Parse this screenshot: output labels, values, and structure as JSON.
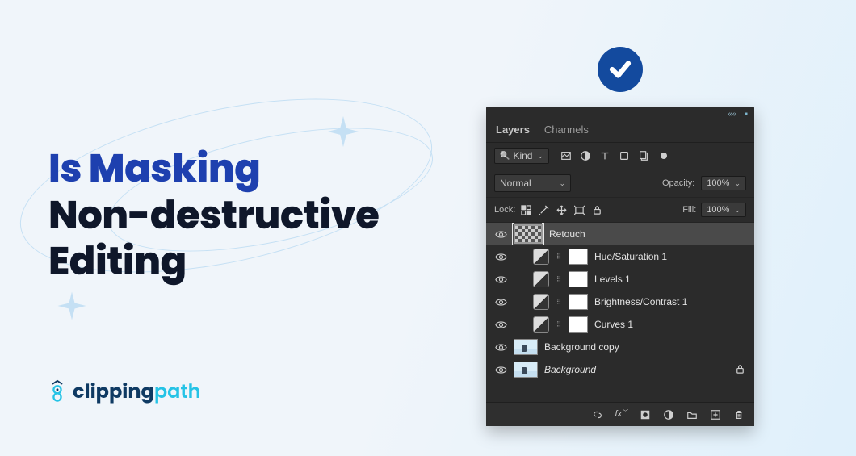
{
  "headline": {
    "line1": "Is Masking",
    "line2": "Non-destructive",
    "line3": "Editing"
  },
  "logo": {
    "part1": "clipping",
    "part2": "path"
  },
  "panel": {
    "tabs": {
      "layers": "Layers",
      "channels": "Channels"
    },
    "kind_label": "Kind",
    "blend_mode": "Normal",
    "opacity_label": "Opacity:",
    "opacity_value": "100%",
    "lock_label": "Lock:",
    "fill_label": "Fill:",
    "fill_value": "100%",
    "layers": [
      {
        "name": "Retouch",
        "type": "checker",
        "visible": true,
        "selected": true,
        "indent": 0,
        "locked": false,
        "italic": false
      },
      {
        "name": "Hue/Saturation 1",
        "type": "adjustment",
        "visible": true,
        "selected": false,
        "indent": 1,
        "locked": false,
        "italic": false
      },
      {
        "name": "Levels 1",
        "type": "adjustment",
        "visible": true,
        "selected": false,
        "indent": 1,
        "locked": false,
        "italic": false
      },
      {
        "name": "Brightness/Contrast 1",
        "type": "adjustment",
        "visible": true,
        "selected": false,
        "indent": 1,
        "locked": false,
        "italic": false
      },
      {
        "name": "Curves 1",
        "type": "adjustment",
        "visible": true,
        "selected": false,
        "indent": 1,
        "locked": false,
        "italic": false
      },
      {
        "name": "Background copy",
        "type": "image",
        "visible": true,
        "selected": false,
        "indent": 0,
        "locked": false,
        "italic": false
      },
      {
        "name": "Background",
        "type": "image",
        "visible": true,
        "selected": false,
        "indent": 0,
        "locked": true,
        "italic": true
      }
    ]
  }
}
